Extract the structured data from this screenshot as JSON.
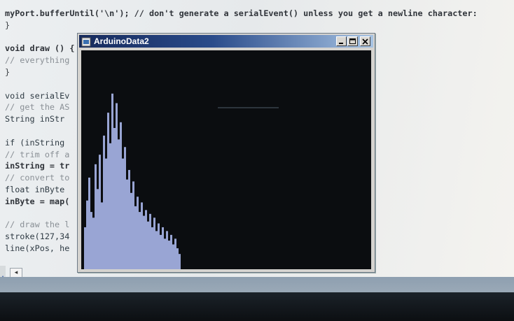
{
  "editor": {
    "lines": [
      {
        "text": "myPort.bufferUntil('\\n'); // don't generate a serialEvent() unless you get a newline character:",
        "style": "bold"
      },
      {
        "text": "}",
        "style": "plain"
      },
      {
        "text": "",
        "style": "plain"
      },
      {
        "text": "void draw () {",
        "style": "bold"
      },
      {
        "text": "// everything",
        "style": "comment"
      },
      {
        "text": "}",
        "style": "plain"
      },
      {
        "text": "",
        "style": "plain"
      },
      {
        "text": "void serialEv",
        "style": "keyword"
      },
      {
        "text": "// get the AS",
        "style": "comment"
      },
      {
        "text": "String inStr",
        "style": "keyword"
      },
      {
        "text": "",
        "style": "plain"
      },
      {
        "text": "if (inString",
        "style": "keyword"
      },
      {
        "text": "// trim off a",
        "style": "comment"
      },
      {
        "text": "inString = tr",
        "style": "bold"
      },
      {
        "text": "// convert to",
        "style": "comment"
      },
      {
        "text": "float inByte",
        "style": "keyword"
      },
      {
        "text": "inByte = map(",
        "style": "bold"
      },
      {
        "text": "",
        "style": "plain"
      },
      {
        "text": "// draw the l",
        "style": "comment"
      },
      {
        "text": "stroke(127,34",
        "style": "keyword"
      },
      {
        "text": "line(xPos, he",
        "style": "keyword"
      }
    ],
    "scroll_left_glyph": "◂",
    "gutter_marks": [
      "A",
      "A"
    ]
  },
  "sketch_window": {
    "title": "ArduinoData2",
    "minimize_icon": "minimize-icon",
    "maximize_icon": "maximize-icon",
    "close_icon": "close-icon",
    "plot_color": "#a9b6ea",
    "background_color": "#0b0d10",
    "plot_samples": [
      0.22,
      0.36,
      0.48,
      0.3,
      0.27,
      0.55,
      0.42,
      0.6,
      0.35,
      0.7,
      0.58,
      0.82,
      0.66,
      0.92,
      0.74,
      0.87,
      0.68,
      0.77,
      0.58,
      0.64,
      0.47,
      0.52,
      0.4,
      0.46,
      0.33,
      0.38,
      0.3,
      0.35,
      0.28,
      0.31,
      0.25,
      0.29,
      0.22,
      0.27,
      0.2,
      0.24,
      0.18,
      0.22,
      0.16,
      0.2,
      0.15,
      0.18,
      0.13,
      0.16,
      0.11,
      0.08
    ]
  },
  "colors": {
    "titlebar_start": "#162a5c",
    "titlebar_end": "#a6c3e3",
    "console_bar": "#94a4b4"
  }
}
